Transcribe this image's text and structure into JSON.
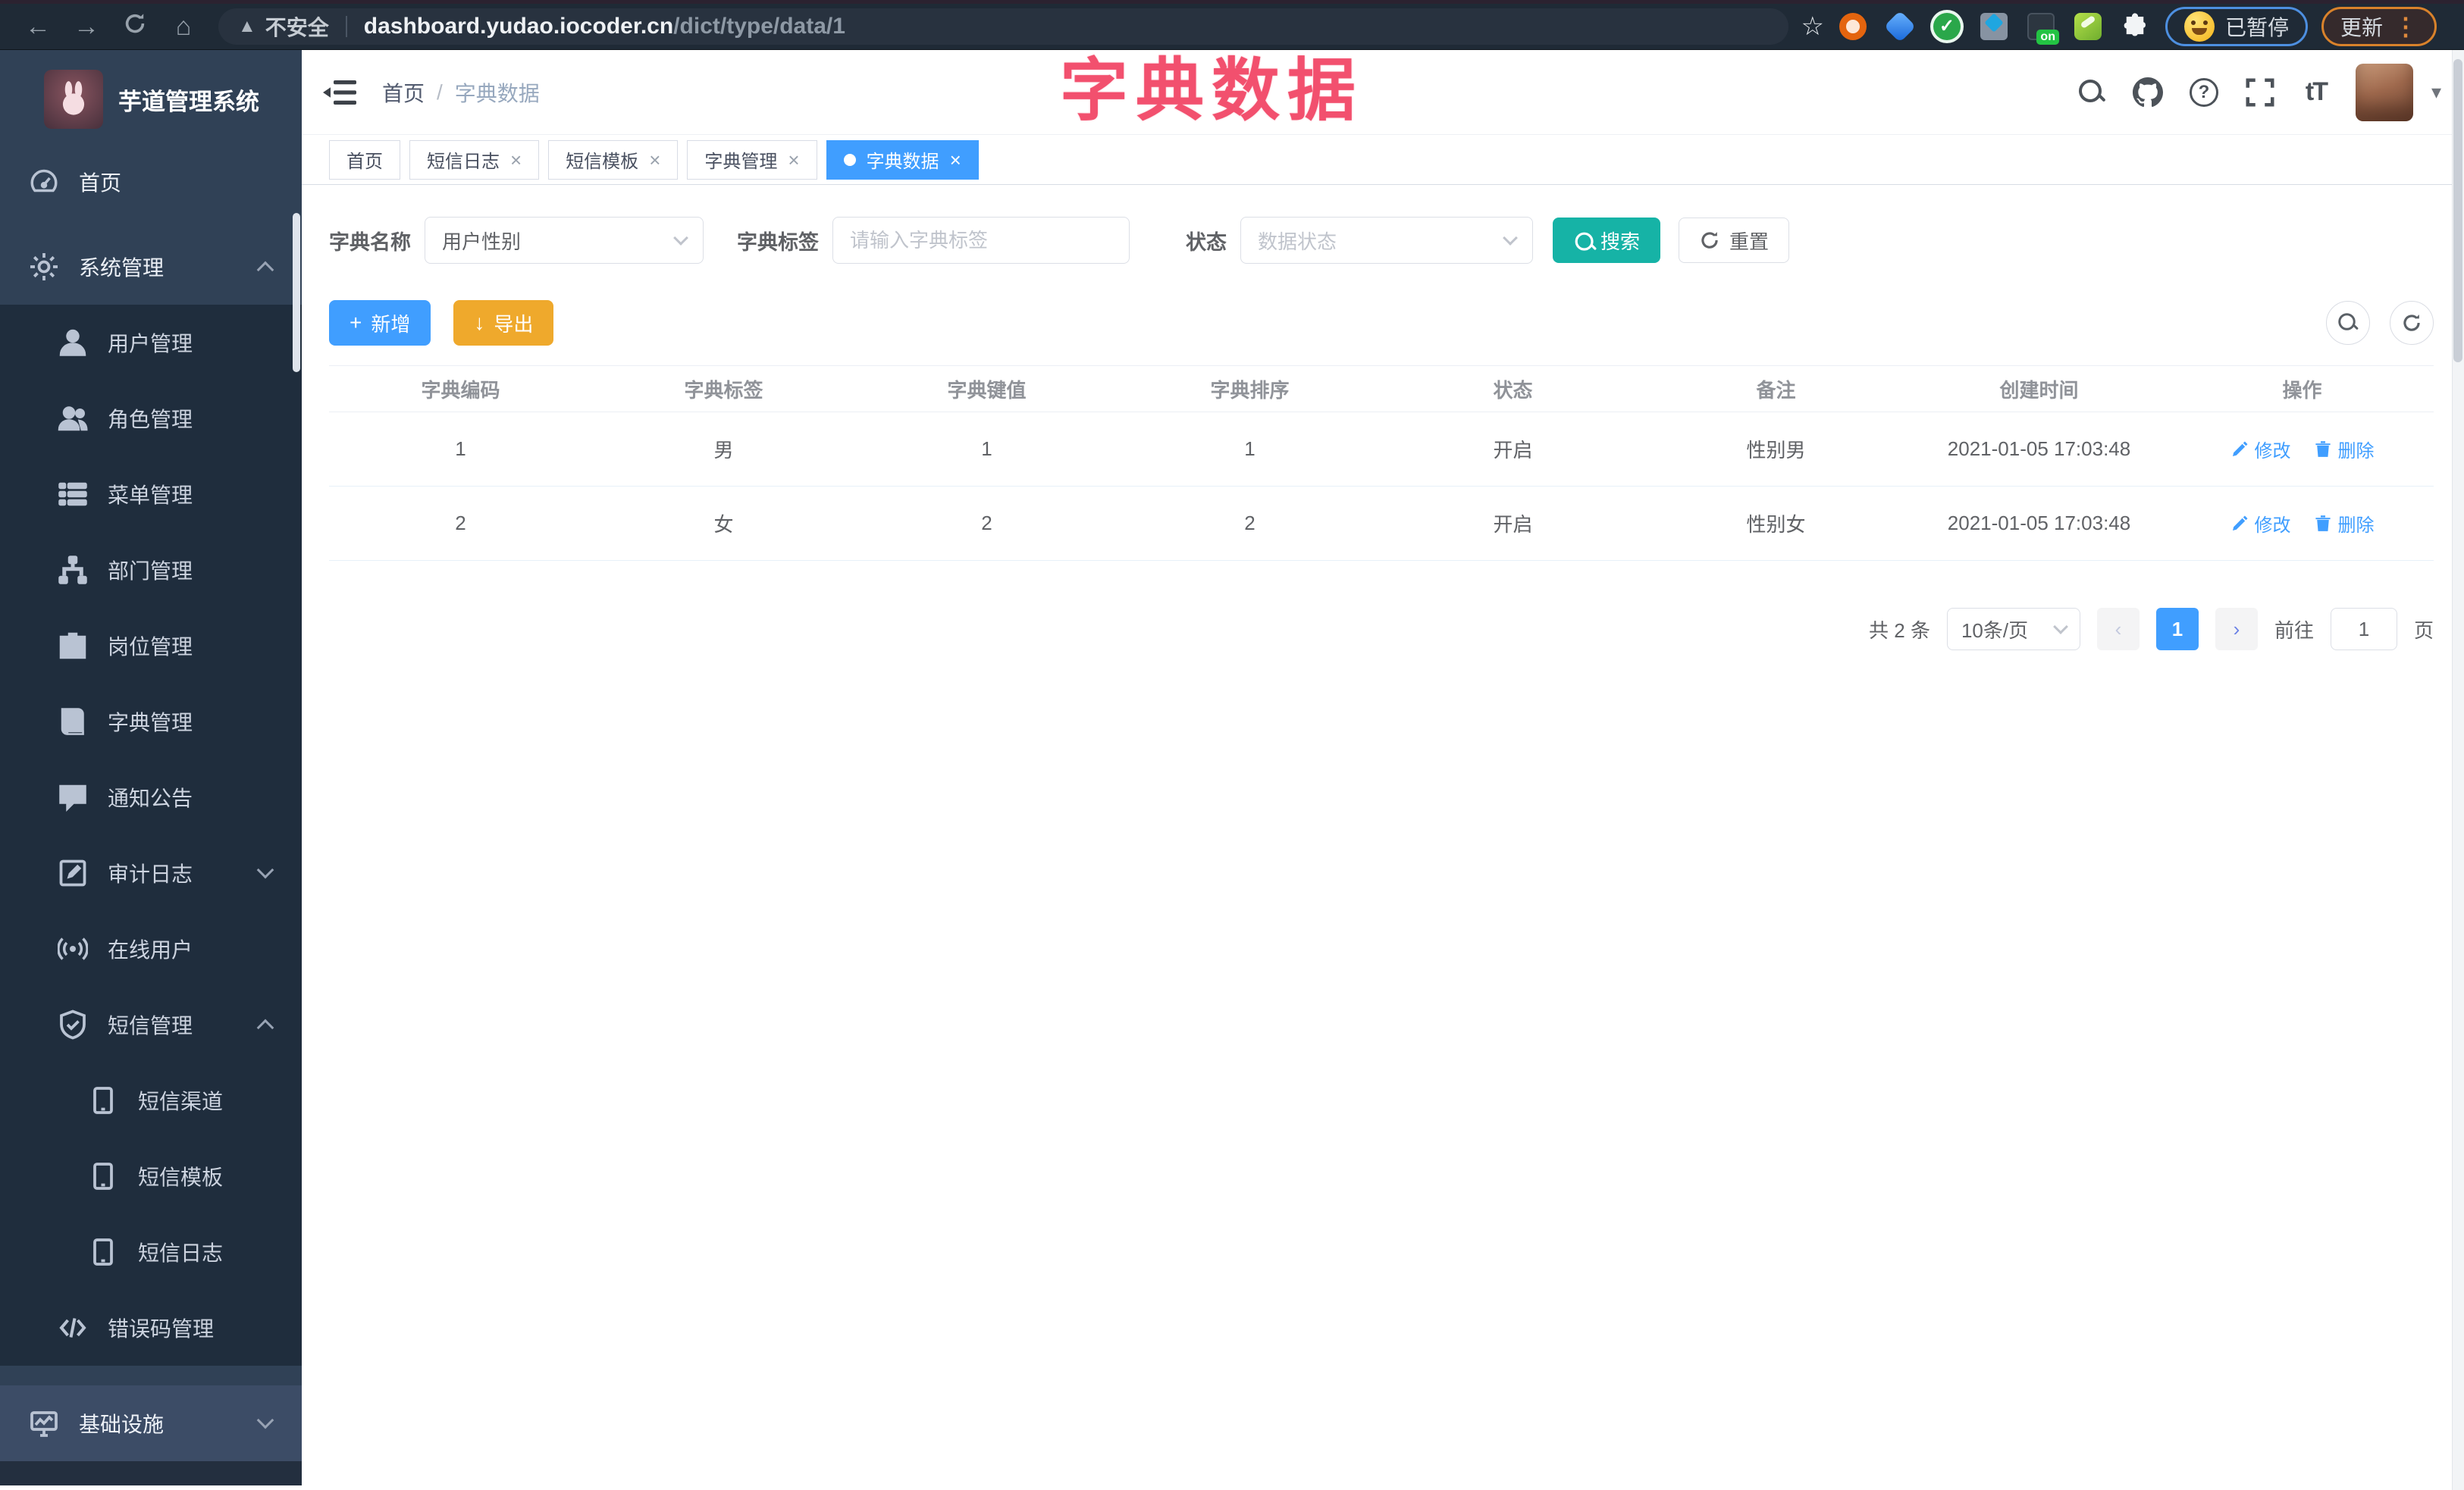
{
  "browser": {
    "security_label": "不安全",
    "url_host": "dashboard.yudao.iocoder.cn",
    "url_path": "/dict/type/data/1",
    "paused_badge": "已暂停",
    "update_button": "更新",
    "extension_on_badge": "on"
  },
  "annotation": {
    "title": "字典数据"
  },
  "icons": {
    "close": "×",
    "back": "←",
    "forward": "→",
    "home": "⌂",
    "star": "☆",
    "warning": "▲",
    "plus": "+",
    "download": "↓",
    "question": "?",
    "font_size": "tT",
    "more_vertical": "⋮",
    "caret_down": "▾"
  },
  "sidebar": {
    "logo_title": "芋道管理系统",
    "items": [
      {
        "label": "首页"
      },
      {
        "label": "系统管理"
      },
      {
        "label": "用户管理"
      },
      {
        "label": "角色管理"
      },
      {
        "label": "菜单管理"
      },
      {
        "label": "部门管理"
      },
      {
        "label": "岗位管理"
      },
      {
        "label": "字典管理"
      },
      {
        "label": "通知公告"
      },
      {
        "label": "审计日志"
      },
      {
        "label": "在线用户"
      },
      {
        "label": "短信管理"
      },
      {
        "label": "短信渠道"
      },
      {
        "label": "短信模板"
      },
      {
        "label": "短信日志"
      },
      {
        "label": "错误码管理"
      },
      {
        "label": "基础设施"
      }
    ]
  },
  "navbar": {
    "breadcrumb_home": "首页",
    "breadcrumb_sep": "/",
    "breadcrumb_current": "字典数据"
  },
  "tabs": [
    {
      "label": "首页"
    },
    {
      "label": "短信日志"
    },
    {
      "label": "短信模板"
    },
    {
      "label": "字典管理"
    },
    {
      "label": "字典数据"
    }
  ],
  "filters": {
    "name_label": "字典名称",
    "name_value": "用户性别",
    "tag_label": "字典标签",
    "tag_placeholder": "请输入字典标签",
    "status_label": "状态",
    "status_placeholder": "数据状态",
    "search_button": "搜索",
    "reset_button": "重置"
  },
  "toolbar": {
    "add_button": "新增",
    "export_button": "导出"
  },
  "table": {
    "columns": [
      "字典编码",
      "字典标签",
      "字典键值",
      "字典排序",
      "状态",
      "备注",
      "创建时间",
      "操作"
    ],
    "rows": [
      {
        "code": "1",
        "label": "男",
        "value": "1",
        "sort": "1",
        "status": "开启",
        "remark": "性别男",
        "created": "2021-01-05 17:03:48"
      },
      {
        "code": "2",
        "label": "女",
        "value": "2",
        "sort": "2",
        "status": "开启",
        "remark": "性别女",
        "created": "2021-01-05 17:03:48"
      }
    ],
    "edit_label": "修改",
    "delete_label": "删除"
  },
  "pagination": {
    "total_label": "共 2 条",
    "page_size": "10条/页",
    "current_page": "1",
    "goto_label": "前往",
    "goto_value": "1",
    "unit_label": "页"
  },
  "colors": {
    "primary": "#409EFF",
    "search_teal": "#16B3A6",
    "export_yellow": "#EFA92C",
    "annotation_red": "#F2506E",
    "sidebar_bg": "#304156",
    "submenu_bg": "#1F2D3D"
  }
}
